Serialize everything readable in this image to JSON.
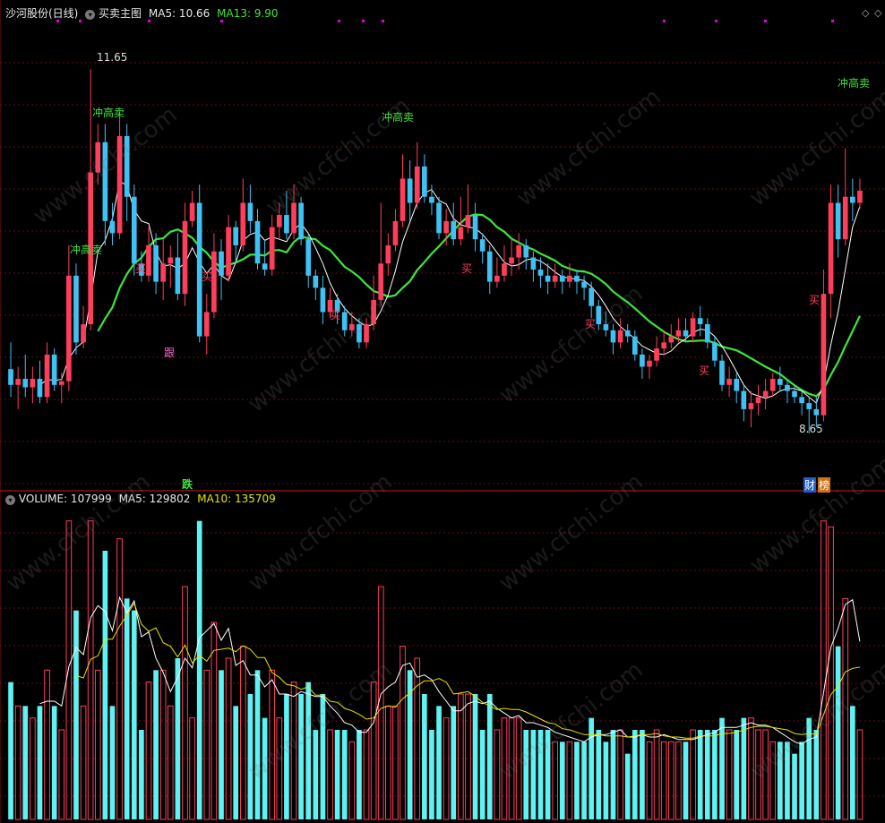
{
  "header": {
    "stock_name": "沙河股份(日线)",
    "indicator_name": "买卖主图",
    "ma5_label": "MA5: 10.66",
    "ma13_label": "MA13: 9.90",
    "volume_label": "VOLUME: 107999",
    "vol_ma5_label": "MA5: 129802",
    "vol_ma10_label": "MA10: 135709"
  },
  "colors": {
    "up": "#ff3e5c",
    "down": "#3fc1f3",
    "ma13": "#3ce63c",
    "ma5": "#ffffff",
    "vol_ma10": "#e8e400",
    "grid": "#8a1010"
  },
  "annotations": {
    "high_price": "11.65",
    "low_price": "8.65",
    "sell_label": "冲高卖",
    "buy_label": "买",
    "follow_label": "跟",
    "fall_label": "跌",
    "fin_label": "财",
    "rank_label": "榜"
  },
  "chart_data": [
    {
      "type": "candlestick",
      "title": "买卖主图",
      "ylim": [
        8.2,
        12.0
      ],
      "series": [
        {
          "name": "MA5",
          "last": 10.66
        },
        {
          "name": "MA13",
          "last": 9.9
        }
      ],
      "candles": [
        [
          9.18,
          9.05,
          9.4,
          8.95
        ],
        [
          9.05,
          9.1,
          9.2,
          8.85
        ],
        [
          9.1,
          9.03,
          9.3,
          8.95
        ],
        [
          9.03,
          9.1,
          9.2,
          8.9
        ],
        [
          9.1,
          8.95,
          9.25,
          8.9
        ],
        [
          8.95,
          9.3,
          9.4,
          8.9
        ],
        [
          9.3,
          9.05,
          9.35,
          9.0
        ],
        [
          9.05,
          9.08,
          9.15,
          8.9
        ],
        [
          9.08,
          9.95,
          10.2,
          9.0
        ],
        [
          9.95,
          9.4,
          10.05,
          9.3
        ],
        [
          9.4,
          9.55,
          9.7,
          9.35
        ],
        [
          9.55,
          10.8,
          11.65,
          9.5
        ],
        [
          10.8,
          11.05,
          11.2,
          10.7
        ],
        [
          11.05,
          10.4,
          11.2,
          10.2
        ],
        [
          10.4,
          10.3,
          10.55,
          10.2
        ],
        [
          10.3,
          11.1,
          11.3,
          10.25
        ],
        [
          11.1,
          10.6,
          11.2,
          10.4
        ],
        [
          10.6,
          10.05,
          10.7,
          9.95
        ],
        [
          10.05,
          9.95,
          10.15,
          9.9
        ],
        [
          9.95,
          10.2,
          10.35,
          9.9
        ],
        [
          10.2,
          9.9,
          10.3,
          9.8
        ],
        [
          9.9,
          10.05,
          10.25,
          9.75
        ],
        [
          10.05,
          10.1,
          10.2,
          9.85
        ],
        [
          10.1,
          9.8,
          10.3,
          9.75
        ],
        [
          9.8,
          10.4,
          10.55,
          9.7
        ],
        [
          10.4,
          10.55,
          10.65,
          10.35
        ],
        [
          10.55,
          9.45,
          10.7,
          9.4
        ],
        [
          9.45,
          9.65,
          9.8,
          9.3
        ],
        [
          9.65,
          10.15,
          10.3,
          9.6
        ],
        [
          10.15,
          9.95,
          10.25,
          9.75
        ],
        [
          9.95,
          10.35,
          10.45,
          9.9
        ],
        [
          10.35,
          10.2,
          10.4,
          10.05
        ],
        [
          10.2,
          10.55,
          10.75,
          10.15
        ],
        [
          10.55,
          10.4,
          10.7,
          10.3
        ],
        [
          10.4,
          10.05,
          10.5,
          10.0
        ],
        [
          10.05,
          10.0,
          10.25,
          9.95
        ],
        [
          10.0,
          10.35,
          10.45,
          9.95
        ],
        [
          10.35,
          10.45,
          10.55,
          10.25
        ],
        [
          10.45,
          10.3,
          10.65,
          10.25
        ],
        [
          10.3,
          10.55,
          10.7,
          10.25
        ],
        [
          10.55,
          10.25,
          10.6,
          10.2
        ],
        [
          10.25,
          9.95,
          10.3,
          9.85
        ],
        [
          9.95,
          9.85,
          10.0,
          9.75
        ],
        [
          9.85,
          9.65,
          9.95,
          9.55
        ],
        [
          9.65,
          9.75,
          9.85,
          9.6
        ],
        [
          9.75,
          9.65,
          9.8,
          9.55
        ],
        [
          9.65,
          9.5,
          9.7,
          9.45
        ],
        [
          9.5,
          9.55,
          9.65,
          9.45
        ],
        [
          9.55,
          9.4,
          9.6,
          9.35
        ],
        [
          9.4,
          9.55,
          9.6,
          9.35
        ],
        [
          9.55,
          9.75,
          9.95,
          9.5
        ],
        [
          9.75,
          10.05,
          10.55,
          9.7
        ],
        [
          10.05,
          10.2,
          10.3,
          9.95
        ],
        [
          10.2,
          10.4,
          10.5,
          10.15
        ],
        [
          10.4,
          10.75,
          10.95,
          10.35
        ],
        [
          10.75,
          10.55,
          10.9,
          10.4
        ],
        [
          10.55,
          10.85,
          11.05,
          10.5
        ],
        [
          10.85,
          10.6,
          10.95,
          10.55
        ],
        [
          10.6,
          10.55,
          10.7,
          10.45
        ],
        [
          10.55,
          10.3,
          10.6,
          10.25
        ],
        [
          10.3,
          10.4,
          10.5,
          10.2
        ],
        [
          10.4,
          10.25,
          10.55,
          10.2
        ],
        [
          10.25,
          10.35,
          10.6,
          10.2
        ],
        [
          10.35,
          10.45,
          10.7,
          10.3
        ],
        [
          10.45,
          10.25,
          10.55,
          10.15
        ],
        [
          10.25,
          10.15,
          10.3,
          10.05
        ],
        [
          10.15,
          9.9,
          10.2,
          9.8
        ],
        [
          9.9,
          9.95,
          10.1,
          9.85
        ],
        [
          9.95,
          10.05,
          10.2,
          9.9
        ],
        [
          10.05,
          10.1,
          10.25,
          9.95
        ],
        [
          10.1,
          10.2,
          10.3,
          10.0
        ],
        [
          10.2,
          10.1,
          10.25,
          10.0
        ],
        [
          10.1,
          10.0,
          10.15,
          9.9
        ],
        [
          10.0,
          9.95,
          10.1,
          9.85
        ],
        [
          9.95,
          9.9,
          10.05,
          9.8
        ],
        [
          9.9,
          9.95,
          10.05,
          9.85
        ],
        [
          9.95,
          9.9,
          10.0,
          9.8
        ],
        [
          9.9,
          9.95,
          10.05,
          9.85
        ],
        [
          9.95,
          9.9,
          10.0,
          9.8
        ],
        [
          9.9,
          9.85,
          9.95,
          9.75
        ],
        [
          9.85,
          9.7,
          9.9,
          9.6
        ],
        [
          9.7,
          9.55,
          9.75,
          9.5
        ],
        [
          9.55,
          9.5,
          9.65,
          9.45
        ],
        [
          9.5,
          9.4,
          9.55,
          9.3
        ],
        [
          9.4,
          9.5,
          9.6,
          9.35
        ],
        [
          9.5,
          9.45,
          9.55,
          9.4
        ],
        [
          9.45,
          9.3,
          9.5,
          9.25
        ],
        [
          9.3,
          9.2,
          9.35,
          9.1
        ],
        [
          9.2,
          9.25,
          9.3,
          9.1
        ],
        [
          9.25,
          9.35,
          9.45,
          9.2
        ],
        [
          9.35,
          9.4,
          9.5,
          9.3
        ],
        [
          9.4,
          9.45,
          9.55,
          9.35
        ],
        [
          9.45,
          9.5,
          9.6,
          9.4
        ],
        [
          9.5,
          9.45,
          9.6,
          9.4
        ],
        [
          9.45,
          9.6,
          9.65,
          9.4
        ],
        [
          9.6,
          9.55,
          9.7,
          9.45
        ],
        [
          9.55,
          9.4,
          9.6,
          9.35
        ],
        [
          9.4,
          9.25,
          9.45,
          9.2
        ],
        [
          9.25,
          9.05,
          9.3,
          9.0
        ],
        [
          9.05,
          9.1,
          9.2,
          8.95
        ],
        [
          9.1,
          9.0,
          9.15,
          8.9
        ],
        [
          9.0,
          8.85,
          9.05,
          8.75
        ],
        [
          8.85,
          8.9,
          9.0,
          8.7
        ],
        [
          8.9,
          8.95,
          9.05,
          8.8
        ],
        [
          8.95,
          9.0,
          9.1,
          8.85
        ],
        [
          9.0,
          9.1,
          9.15,
          8.95
        ],
        [
          9.1,
          9.05,
          9.2,
          9.0
        ],
        [
          9.05,
          9.0,
          9.1,
          8.9
        ],
        [
          9.0,
          8.95,
          9.05,
          8.9
        ],
        [
          8.95,
          8.9,
          9.0,
          8.8
        ],
        [
          8.9,
          8.85,
          8.95,
          8.65
        ],
        [
          8.85,
          8.8,
          8.95,
          8.7
        ],
        [
          8.8,
          9.8,
          10.0,
          8.75
        ],
        [
          9.8,
          10.55,
          10.7,
          9.6
        ],
        [
          10.55,
          10.25,
          10.7,
          10.1
        ],
        [
          10.25,
          10.6,
          11.0,
          10.2
        ],
        [
          10.6,
          10.55,
          10.75,
          10.4
        ],
        [
          10.55,
          10.65,
          10.75,
          10.5
        ]
      ]
    },
    {
      "type": "bar",
      "title": "VOLUME",
      "series": [
        {
          "name": "VOLUME",
          "last": 107999
        },
        {
          "name": "MA5",
          "last": 129802
        },
        {
          "name": "MA10",
          "last": 135709
        }
      ],
      "ylim": [
        0,
        420000
      ]
    }
  ]
}
